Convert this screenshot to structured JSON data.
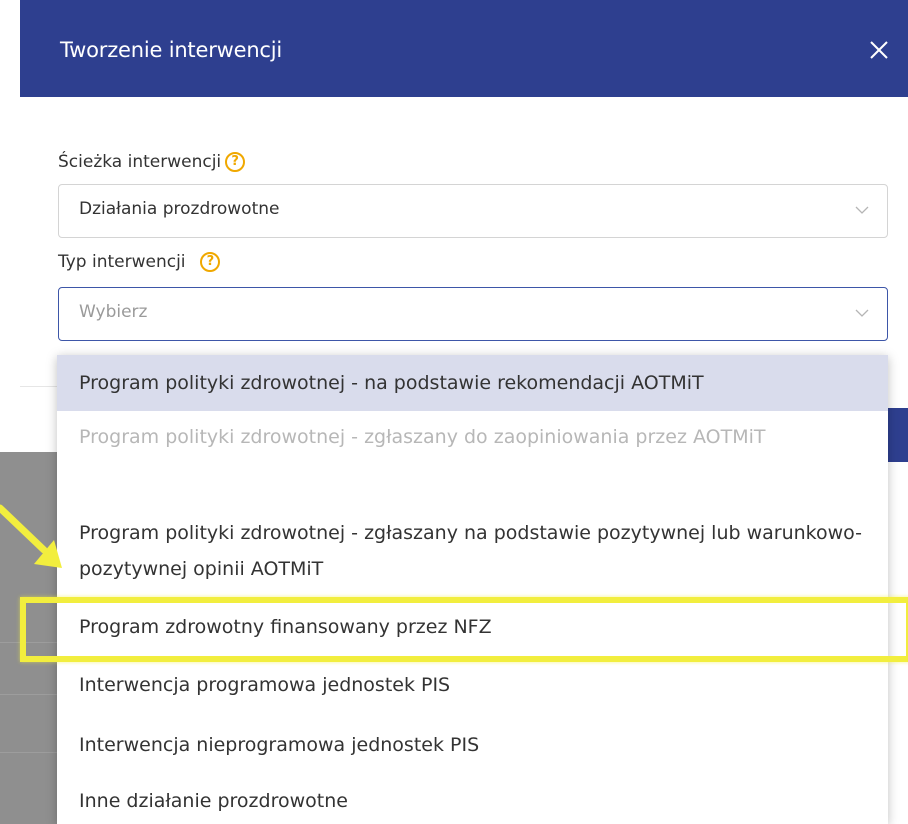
{
  "modal": {
    "title": "Tworzenie interwencji",
    "close_icon": "close-icon"
  },
  "path_field": {
    "label": "Ścieżka interwencji",
    "help_icon": "?",
    "value": "Działania prozdrowotne"
  },
  "type_field": {
    "label": "Typ interwencji",
    "help_icon": "?",
    "placeholder": "Wybierz"
  },
  "dropdown": {
    "options": [
      "Program polityki zdrowotnej - na podstawie rekomendacji AOTMiT",
      "Program polityki zdrowotnej - zgłaszany do zaopiniowania przez AOTMiT",
      "Program polityki zdrowotnej - zgłaszany na podstawie pozytywnej lub warunkowo-pozytywnej opinii AOTMiT",
      "Program zdrowotny finansowany przez NFZ",
      "Interwencja programowa jednostek PIS",
      "Interwencja nieprogramowa jednostek PIS",
      "Inne działanie prozdrowotne"
    ],
    "highlighted_index": 0,
    "disabled_index": 1
  },
  "colors": {
    "header": "#2e3f8f",
    "highlight_option": "#d9dcec",
    "annotation": "#f2ee3e",
    "help_icon": "#f0a800"
  }
}
